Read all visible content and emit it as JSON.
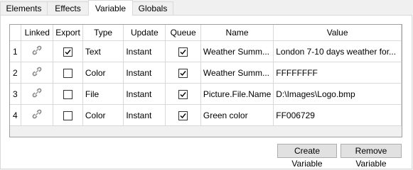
{
  "tabs": [
    {
      "label": "Elements"
    },
    {
      "label": "Effects"
    },
    {
      "label": "Variable"
    },
    {
      "label": "Globals"
    }
  ],
  "active_tab": "Variable",
  "columns": [
    "",
    "Linked",
    "Export",
    "Type",
    "Update",
    "Queue",
    "Name",
    "Value"
  ],
  "rows": [
    {
      "num": "1",
      "linked": "link-icon",
      "export": true,
      "type": "Text",
      "update": "Instant",
      "queue": true,
      "name": "Weather Summ...",
      "value": "London 7-10 days weather for..."
    },
    {
      "num": "2",
      "linked": "link-icon",
      "export": false,
      "type": "Color",
      "update": "Instant",
      "queue": true,
      "name": "Weather Summ...",
      "value": "FFFFFFFF"
    },
    {
      "num": "3",
      "linked": "link-icon",
      "export": false,
      "type": "File",
      "update": "Instant",
      "queue": true,
      "name": "Picture.File.Name",
      "value": "D:\\Images\\Logo.bmp"
    },
    {
      "num": "4",
      "linked": "link-icon",
      "export": false,
      "type": "Color",
      "update": "Instant",
      "queue": true,
      "name": "Green color",
      "value": "FF006729"
    }
  ],
  "buttons": {
    "create": "Create Variable",
    "remove": "Remove Variable"
  }
}
